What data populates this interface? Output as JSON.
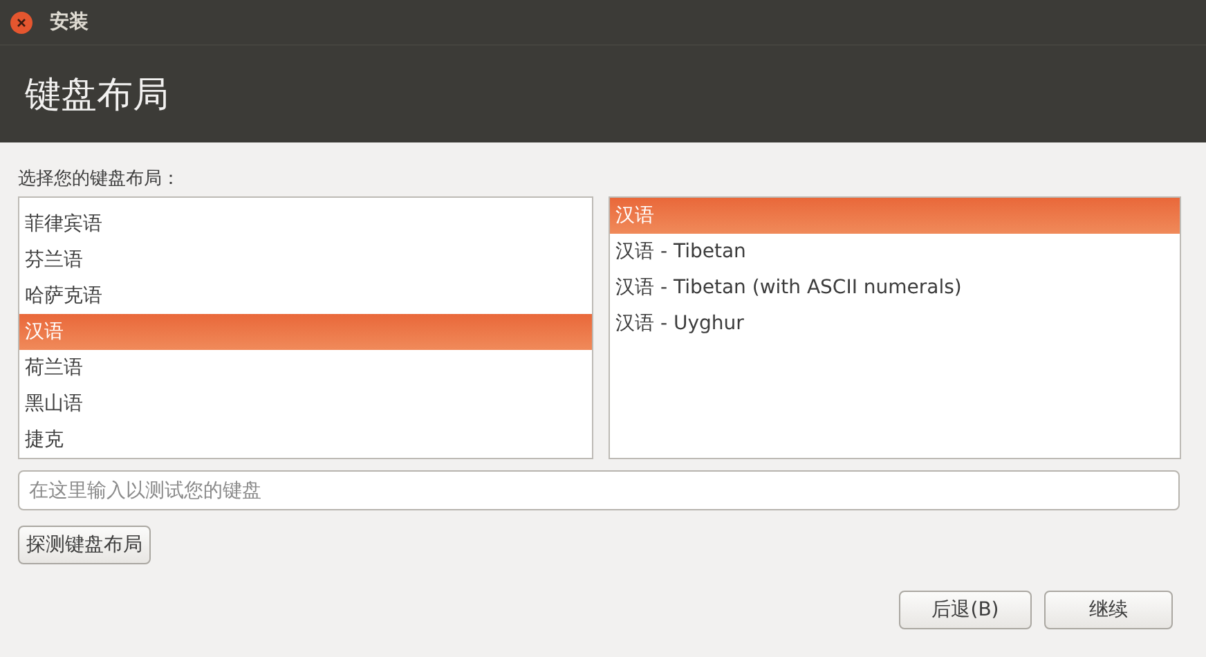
{
  "window": {
    "title": "安装"
  },
  "header": {
    "title": "键盘布局"
  },
  "layout_label": "选择您的键盘布局：",
  "layouts": [
    {
      "label": "菲律宾语",
      "selected": false
    },
    {
      "label": "芬兰语",
      "selected": false
    },
    {
      "label": "哈萨克语",
      "selected": false
    },
    {
      "label": "汉语",
      "selected": true
    },
    {
      "label": "荷兰语",
      "selected": false
    },
    {
      "label": "黑山语",
      "selected": false
    },
    {
      "label": "捷克",
      "selected": false
    }
  ],
  "variants": [
    {
      "label": "汉语",
      "selected": true
    },
    {
      "label": "汉语 - Tibetan",
      "selected": false
    },
    {
      "label": "汉语 - Tibetan (with ASCII numerals)",
      "selected": false
    },
    {
      "label": "汉语 - Uyghur",
      "selected": false
    }
  ],
  "test_field": {
    "placeholder": "在这里输入以测试您的键盘"
  },
  "detect_button": "探测键盘布局",
  "buttons": [
    {
      "label": "后退(B)"
    },
    {
      "label": "继续"
    }
  ]
}
